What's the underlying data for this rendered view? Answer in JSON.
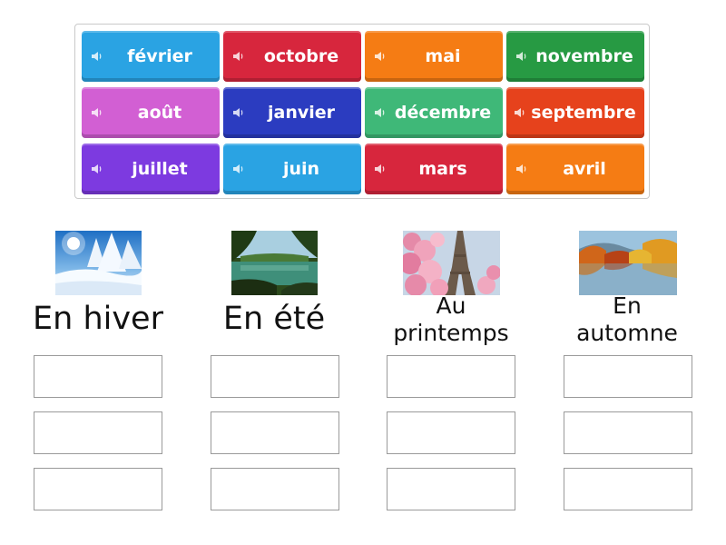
{
  "colors": {
    "blue": "#2aa3e3",
    "red": "#d7263d",
    "orange": "#f57c14",
    "green": "#279a43",
    "pink": "#d25fd3",
    "navy": "#2b3cc0",
    "mint": "#3fb878",
    "redorange": "#e6421c",
    "purple": "#7d3ae0"
  },
  "speaker_icon": "speaker-icon",
  "tiles": [
    {
      "label": "février",
      "color": "#2aa3e3"
    },
    {
      "label": "octobre",
      "color": "#d7263d"
    },
    {
      "label": "mai",
      "color": "#f57c14"
    },
    {
      "label": "novembre",
      "color": "#279a43"
    },
    {
      "label": "août",
      "color": "#d25fd3"
    },
    {
      "label": "janvier",
      "color": "#2b3cc0"
    },
    {
      "label": "décembre",
      "color": "#3fb878"
    },
    {
      "label": "septembre",
      "color": "#e6421c"
    },
    {
      "label": "juillet",
      "color": "#7d3ae0"
    },
    {
      "label": "juin",
      "color": "#2aa3e3"
    },
    {
      "label": "mars",
      "color": "#d7263d"
    },
    {
      "label": "avril",
      "color": "#f57c14"
    }
  ],
  "columns": [
    {
      "title": "En hiver",
      "image": "winter-snow-trees-image"
    },
    {
      "title": "En été",
      "image": "summer-lake-forest-image"
    },
    {
      "title": "Au printemps",
      "title_line1": "Au",
      "title_line2": "printemps",
      "image": "spring-blossom-eiffel-image"
    },
    {
      "title": "En automne",
      "title_line1": "En",
      "title_line2": "automne",
      "image": "autumn-lake-trees-image"
    }
  ]
}
